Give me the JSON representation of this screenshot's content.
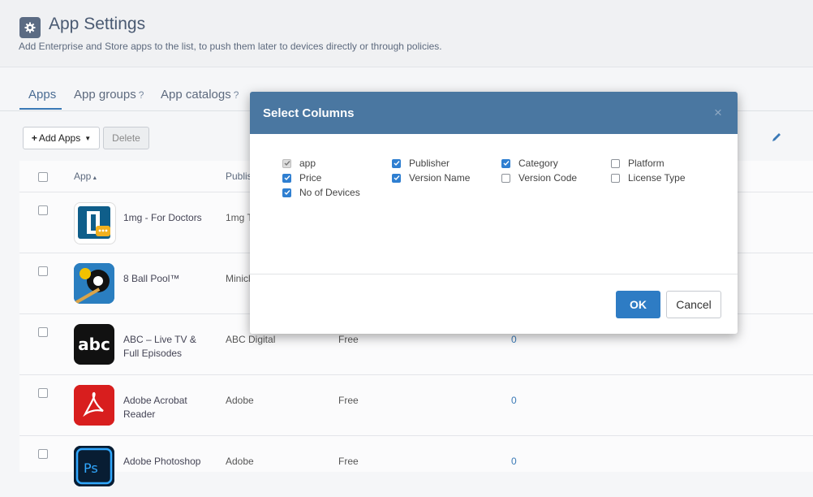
{
  "header": {
    "title": "App Settings",
    "subtitle": "Add Enterprise and Store apps to the list, to push them later to devices directly or through policies."
  },
  "tabs": [
    {
      "label": "Apps"
    },
    {
      "label": "App groups",
      "help": "?"
    },
    {
      "label": "App catalogs",
      "help": "?"
    }
  ],
  "toolbar": {
    "add_label": "Add Apps",
    "delete_label": "Delete"
  },
  "table": {
    "headers": {
      "app": "App",
      "publisher": "Publis"
    },
    "rows": [
      {
        "name": "1mg - For Doctors",
        "publisher": "1mg T",
        "price": "",
        "devices": "",
        "icon": "1mg-icon"
      },
      {
        "name": "8 Ball Pool™",
        "publisher": "Minicl",
        "price": "",
        "devices": "",
        "icon": "8-ball-pool-icon"
      },
      {
        "name": "ABC – Live TV & Full Episodes",
        "publisher": "ABC Digital",
        "price": "Free",
        "devices": "0",
        "icon": "abc-icon"
      },
      {
        "name": "Adobe Acrobat Reader",
        "publisher": "Adobe",
        "price": "Free",
        "devices": "0",
        "icon": "adobe-acrobat-icon"
      },
      {
        "name": "Adobe Photoshop",
        "publisher": "Adobe",
        "price": "Free",
        "devices": "0",
        "icon": "adobe-photoshop-icon"
      }
    ]
  },
  "modal": {
    "title": "Select Columns",
    "close": "×",
    "options": [
      {
        "label": "app",
        "checked": true,
        "disabled": true
      },
      {
        "label": "Publisher",
        "checked": true
      },
      {
        "label": "Category",
        "checked": true
      },
      {
        "label": "Platform",
        "checked": false
      },
      {
        "label": "Price",
        "checked": true
      },
      {
        "label": "Version Name",
        "checked": true
      },
      {
        "label": "Version Code",
        "checked": false
      },
      {
        "label": "License Type",
        "checked": false
      },
      {
        "label": "No of Devices",
        "checked": true
      }
    ],
    "ok_label": "OK",
    "cancel_label": "Cancel"
  },
  "colors": {
    "accent": "#2e7cc4",
    "modal_header": "#4a77a1",
    "title": "#4a5a72"
  }
}
